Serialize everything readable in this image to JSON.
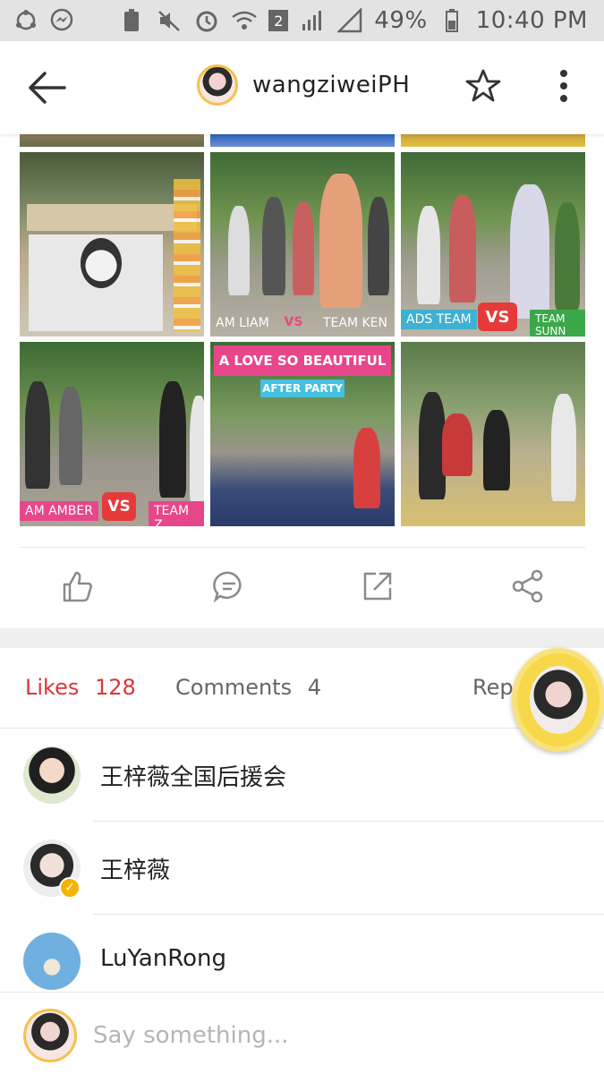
{
  "status_bar": {
    "battery": "49%",
    "time": "10:40 PM",
    "sim_badge": "2"
  },
  "header": {
    "title": "wangziweiPH"
  },
  "grid": {
    "cells": [
      {
        "team_left": "AM LIAM",
        "vs": "VS",
        "team_right": "TEAM KEN"
      },
      {
        "team_left": "ADS TEAM",
        "vs": "VS",
        "team_right": "TEAM SUNN"
      },
      {
        "team_left": "AM AMBER",
        "vs": "VS",
        "team_right": "TEAM Z"
      }
    ],
    "banner_title": "A LOVE SO BEAUTIFUL",
    "banner_subtitle": "AFTER PARTY"
  },
  "tabs": {
    "likes_label": "Likes",
    "likes_count": "128",
    "comments_label": "Comments",
    "comments_count": "4",
    "reposts_label": "Rep"
  },
  "likes_list": [
    {
      "name": "王梓薇全国后援会"
    },
    {
      "name": "王梓薇"
    },
    {
      "name": "LuYanRong"
    }
  ],
  "comment_bar": {
    "placeholder": "Say something..."
  },
  "colors": {
    "accent": "#e0333a",
    "verified": "#f5b400"
  },
  "icons": [
    "back-arrow-icon",
    "star-icon",
    "more-vertical-icon",
    "thumbs-up-icon",
    "comment-icon",
    "external-link-icon",
    "share-icon"
  ]
}
